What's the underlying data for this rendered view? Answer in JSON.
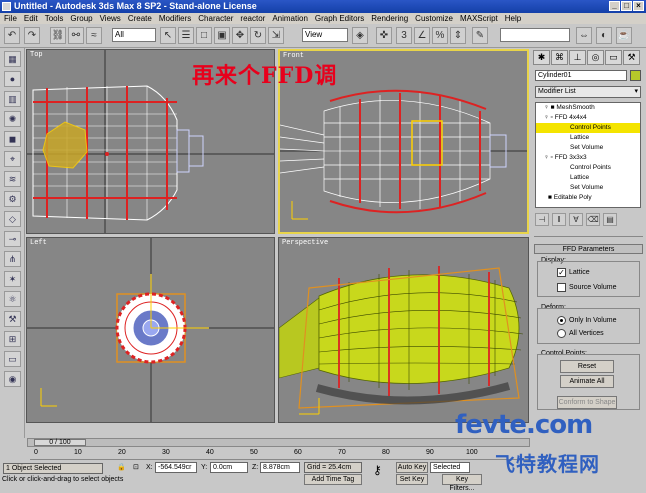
{
  "window": {
    "title": "Untitled - Autodesk 3ds Max 8 SP2 - Stand-alone License"
  },
  "menu": [
    "File",
    "Edit",
    "Tools",
    "Group",
    "Views",
    "Create",
    "Modifiers",
    "Character",
    "reactor",
    "Animation",
    "Graph Editors",
    "Rendering",
    "Customize",
    "MAXScript",
    "Help"
  ],
  "toolbar": {
    "selection_filter": "All",
    "ref_coord": "View"
  },
  "viewports": {
    "top": {
      "label": "Top"
    },
    "front": {
      "label": "Front"
    },
    "left": {
      "label": "Left"
    },
    "perspective": {
      "label": "Perspective"
    }
  },
  "overlay": {
    "text": "再来个FFD调"
  },
  "command_panel": {
    "object_name": "Cylinder01",
    "modifier_list": "Modifier List",
    "stack": [
      {
        "label": "MeshSmooth",
        "indent": 0
      },
      {
        "label": "FFD 4x4x4",
        "indent": 0
      },
      {
        "label": "Control Points",
        "indent": 1,
        "selected": true
      },
      {
        "label": "Lattice",
        "indent": 1
      },
      {
        "label": "Set Volume",
        "indent": 1
      },
      {
        "label": "FFD 3x3x3",
        "indent": 0
      },
      {
        "label": "Control Points",
        "indent": 1
      },
      {
        "label": "Lattice",
        "indent": 1
      },
      {
        "label": "Set Volume",
        "indent": 1
      },
      {
        "label": "Editable Poly",
        "indent": 0
      }
    ],
    "rollout_title": "FFD Parameters",
    "display_label": "Display:",
    "lattice_label": "Lattice",
    "lattice_checked": true,
    "source_volume_label": "Source Volume",
    "deform_label": "Deform:",
    "only_in_volume": "Only In Volume",
    "all_vertices": "All Vertices",
    "control_points_label": "Control Points:",
    "reset_button": "Reset",
    "animate_all_button": "Animate All",
    "conform_button": "Conform to Shape"
  },
  "timeline": {
    "position": "0 / 100",
    "ticks": [
      "0",
      "10",
      "20",
      "30",
      "40",
      "50",
      "60",
      "70",
      "80",
      "90",
      "100"
    ]
  },
  "status": {
    "selection": "1 Object Selected",
    "prompt": "Click or click-and-drag to select objects",
    "x_label": "X:",
    "x_value": "-564.549cr",
    "y_label": "Y:",
    "y_value": "0.0cm",
    "z_label": "Z:",
    "z_value": "8.878cm",
    "grid": "Grid = 25.4cm",
    "add_time_tag": "Add Time Tag",
    "auto_key": "Auto Key",
    "selected": "Selected",
    "set_key": "Set Key",
    "key_filters": "Key Filters..."
  },
  "watermark": {
    "line1": "fevte.com",
    "line2": "飞特教程网"
  }
}
